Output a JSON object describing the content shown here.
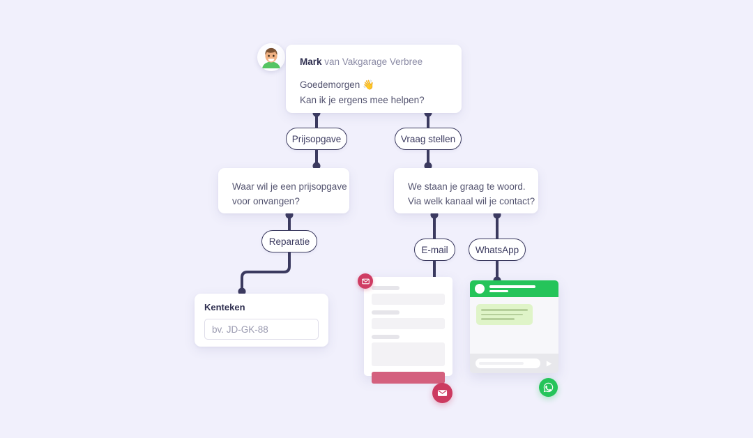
{
  "theme": {
    "background": "#f1f0fc",
    "line": "#3b3a5f",
    "green": "#25c45a",
    "pink": "#cc3a60",
    "pink_bar": "#d4607e",
    "card": "#ffffff"
  },
  "intro": {
    "avatar_icon": "person-avatar-icon",
    "sender_name": "Mark",
    "sender_org": " van Vakgarage Verbree",
    "line1": "Goedemorgen 👋",
    "line2": "Kan ik je ergens mee helpen?"
  },
  "options": {
    "prijsopgave": "Prijsopgave",
    "vraag_stellen": "Vraag stellen",
    "reparatie": "Reparatie",
    "email": "E-mail",
    "whatsapp": "WhatsApp"
  },
  "bot_left": {
    "line1": "Waar wil je een prijsopgave",
    "line2": "voor onvangen?"
  },
  "bot_right": {
    "line1": "We staan je graag te woord.",
    "line2": "Via welk kanaal wil je contact?"
  },
  "kenteken": {
    "label": "Kenteken",
    "placeholder": "bv. JD-GK-88",
    "value": "",
    "submit_icon": "chevron-right-icon"
  },
  "email_mock": {
    "badge_icon": "envelope-icon",
    "field_count": 3,
    "submit_color": "#d4607e"
  },
  "whatsapp_mock": {
    "header_color": "#25c45a",
    "bubble_color": "#dff4c8",
    "send_icon": "send-triangle-icon"
  },
  "badges": {
    "email_icon": "envelope-icon",
    "whatsapp_icon": "whatsapp-icon"
  }
}
